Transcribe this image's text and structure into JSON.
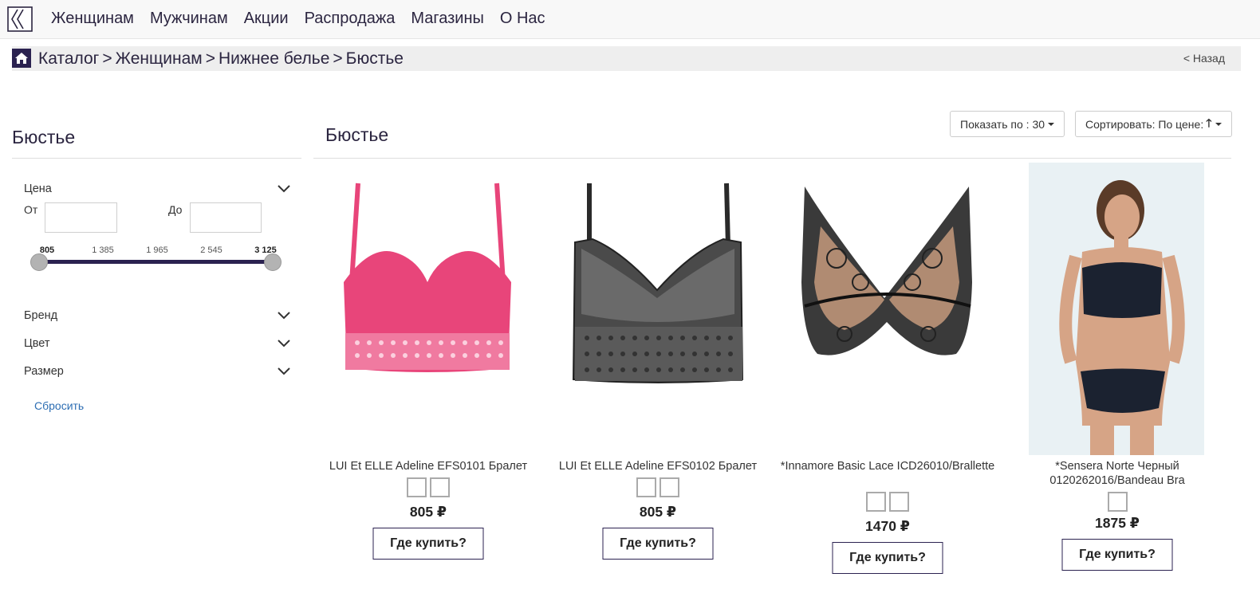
{
  "nav": {
    "items": [
      "Женщинам",
      "Мужчинам",
      "Акции",
      "Распродажа",
      "Магазины",
      "О Нас"
    ]
  },
  "breadcrumb": {
    "items": [
      "Каталог",
      "Женщинам",
      "Нижнее белье",
      "Бюстье"
    ],
    "separator": ">",
    "back": "< Назад"
  },
  "sidebar": {
    "title": "Бюстье",
    "price": {
      "label": "Цена",
      "from_label": "От",
      "to_label": "До",
      "from_value": "",
      "to_value": "",
      "ticks": [
        "805",
        "1 385",
        "1 965",
        "2 545",
        "3 125"
      ]
    },
    "filters": [
      "Бренд",
      "Цвет",
      "Размер"
    ],
    "reset": "Сбросить"
  },
  "main": {
    "title": "Бюстье",
    "show_per_page": "Показать по : 30",
    "sort": "Сортировать: По цене:"
  },
  "products": [
    {
      "name": "LUI Et ELLE Adeline EFS0101 Бралет",
      "price": "805 ₽",
      "swatches": 2,
      "buy": "Где купить?",
      "color": "#e8457a"
    },
    {
      "name": "LUI Et ELLE Adeline EFS0102 Бралет",
      "price": "805 ₽",
      "swatches": 2,
      "buy": "Где купить?",
      "color": "#3a3a3a"
    },
    {
      "name": "*Innamore Basic Lace ICD26010/Brallette",
      "price": "1470 ₽",
      "swatches": 2,
      "buy": "Где купить?",
      "color": "#2a2a2a"
    },
    {
      "name": "*Sensera Norte Черный 0120262016/Bandeau Bra",
      "price": "1875 ₽",
      "swatches": 1,
      "buy": "Где купить?",
      "color": "#1b2230"
    }
  ],
  "colors": {
    "accent": "#2b2250",
    "text": "#2b2540",
    "link": "#2d6eb3"
  }
}
